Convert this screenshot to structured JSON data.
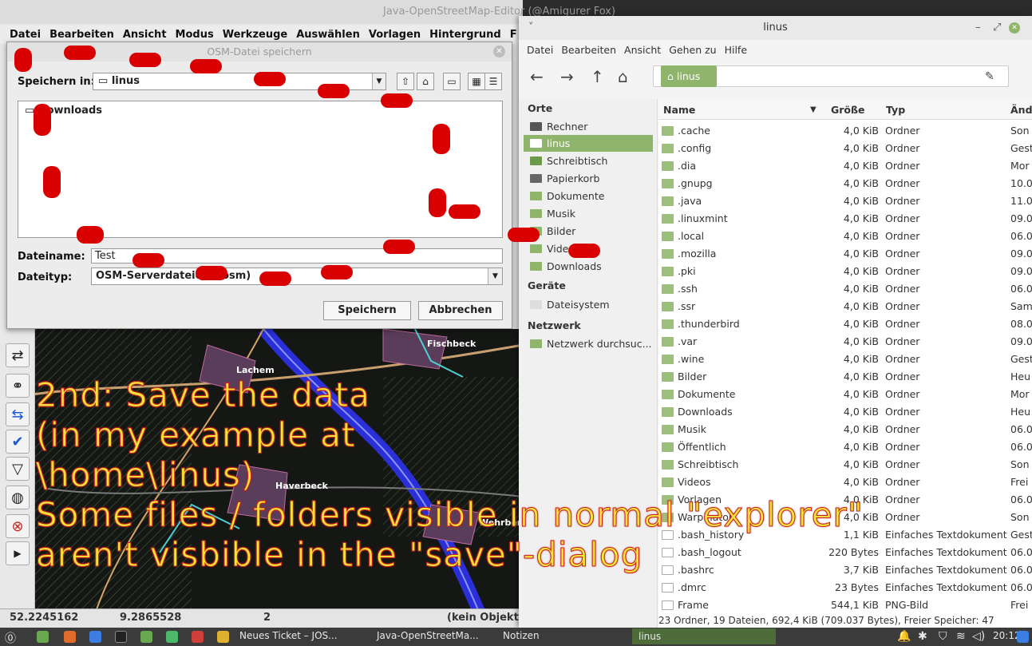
{
  "josm": {
    "title": "Java-OpenStreetMap-Editor (@Amigurer Fox)",
    "menu": [
      "Datei",
      "Bearbeiten",
      "Ansicht",
      "Modus",
      "Werkzeuge",
      "Auswählen",
      "Vorlagen",
      "Hintergrund",
      "F"
    ],
    "status": {
      "lat": "52.2245162",
      "lon": "9.2865528",
      "num": "2",
      "sel": "(kein Objekt)"
    },
    "map_labels": {
      "lachem": "Lachem",
      "fischbeck": "Fischbeck",
      "haverbeck": "Haverbeck",
      "wehrbergen": "Wehrberg"
    }
  },
  "dialog": {
    "title": "OSM-Datei speichern",
    "save_in_label": "Speichern in:",
    "save_in_value": "linus",
    "file_item": "Downloads",
    "filename_label": "Dateiname:",
    "filename_value": "Test",
    "filetype_label": "Dateityp:",
    "filetype_value": "OSM-Serverdateien (.osm)",
    "save_button": "Speichern",
    "cancel_button": "Abbrechen"
  },
  "nemo": {
    "title": "linus",
    "menu": [
      "Datei",
      "Bearbeiten",
      "Ansicht",
      "Gehen zu",
      "Hilfe"
    ],
    "breadcrumb": "linus",
    "sidebar": {
      "places_header": "Orte",
      "places": [
        "Rechner",
        "linus",
        "Schreibtisch",
        "Papierkorb",
        "Dokumente",
        "Musik",
        "Bilder",
        "Videos",
        "Downloads"
      ],
      "devices_header": "Geräte",
      "devices": [
        "Dateisystem"
      ],
      "network_header": "Netzwerk",
      "network": [
        "Netzwerk durchsuc..."
      ]
    },
    "columns": {
      "name": "Name",
      "size": "Größe",
      "type": "Typ",
      "modified": "Änd"
    },
    "rows": [
      {
        "name": ".cache",
        "size": "4,0 KiB",
        "type": "Ordner",
        "mod": "Son"
      },
      {
        "name": ".config",
        "size": "4,0 KiB",
        "type": "Ordner",
        "mod": "Gest"
      },
      {
        "name": ".dia",
        "size": "4,0 KiB",
        "type": "Ordner",
        "mod": "Mor"
      },
      {
        "name": ".gnupg",
        "size": "4,0 KiB",
        "type": "Ordner",
        "mod": "10.0"
      },
      {
        "name": ".java",
        "size": "4,0 KiB",
        "type": "Ordner",
        "mod": "11.0"
      },
      {
        "name": ".linuxmint",
        "size": "4,0 KiB",
        "type": "Ordner",
        "mod": "09.0"
      },
      {
        "name": ".local",
        "size": "4,0 KiB",
        "type": "Ordner",
        "mod": "06.0"
      },
      {
        "name": ".mozilla",
        "size": "4,0 KiB",
        "type": "Ordner",
        "mod": "09.0"
      },
      {
        "name": ".pki",
        "size": "4,0 KiB",
        "type": "Ordner",
        "mod": "09.0"
      },
      {
        "name": ".ssh",
        "size": "4,0 KiB",
        "type": "Ordner",
        "mod": "06.0"
      },
      {
        "name": ".ssr",
        "size": "4,0 KiB",
        "type": "Ordner",
        "mod": "Sam"
      },
      {
        "name": ".thunderbird",
        "size": "4,0 KiB",
        "type": "Ordner",
        "mod": "08.0"
      },
      {
        "name": ".var",
        "size": "4,0 KiB",
        "type": "Ordner",
        "mod": "09.0"
      },
      {
        "name": ".wine",
        "size": "4,0 KiB",
        "type": "Ordner",
        "mod": "Gest"
      },
      {
        "name": "Bilder",
        "size": "4,0 KiB",
        "type": "Ordner",
        "mod": "Heu"
      },
      {
        "name": "Dokumente",
        "size": "4,0 KiB",
        "type": "Ordner",
        "mod": "Mor"
      },
      {
        "name": "Downloads",
        "size": "4,0 KiB",
        "type": "Ordner",
        "mod": "Heu"
      },
      {
        "name": "Musik",
        "size": "4,0 KiB",
        "type": "Ordner",
        "mod": "06.0"
      },
      {
        "name": "Öffentlich",
        "size": "4,0 KiB",
        "type": "Ordner",
        "mod": "06.0"
      },
      {
        "name": "Schreibtisch",
        "size": "4,0 KiB",
        "type": "Ordner",
        "mod": "Son"
      },
      {
        "name": "Videos",
        "size": "4,0 KiB",
        "type": "Ordner",
        "mod": "Frei"
      },
      {
        "name": "Vorlagen",
        "size": "4,0 KiB",
        "type": "Ordner",
        "mod": "06.0"
      },
      {
        "name": "Warpinator",
        "size": "4,0 KiB",
        "type": "Ordner",
        "mod": "Son"
      },
      {
        "name": ".bash_history",
        "size": "1,1 KiB",
        "type": "Einfaches Textdokument",
        "mod": "Gest"
      },
      {
        "name": ".bash_logout",
        "size": "220 Bytes",
        "type": "Einfaches Textdokument",
        "mod": "06.0"
      },
      {
        "name": ".bashrc",
        "size": "3,7 KiB",
        "type": "Einfaches Textdokument",
        "mod": "06.0"
      },
      {
        "name": ".dmrc",
        "size": "23 Bytes",
        "type": "Einfaches Textdokument",
        "mod": "06.0"
      },
      {
        "name": "Frame",
        "size": "544,1 KiB",
        "type": "PNG-Bild",
        "mod": "Frei"
      }
    ],
    "status": "23 Ordner, 19 Dateien, 692,4 KiB (709.037 Bytes), Freier Speicher: 47"
  },
  "overlay": {
    "line1": "2nd: Save the data",
    "line2": "(in my example at",
    "line3": "\\home\\linus)",
    "line4": "Some files / folders visible in normal \"explorer\"",
    "line5": "aren't visbible in the \"save\"-dialog"
  },
  "taskbar": {
    "items": [
      "Neues Ticket – JOS...",
      "Java-OpenStreetMa...",
      "Notizen",
      "linus"
    ],
    "clock": "20:12"
  }
}
